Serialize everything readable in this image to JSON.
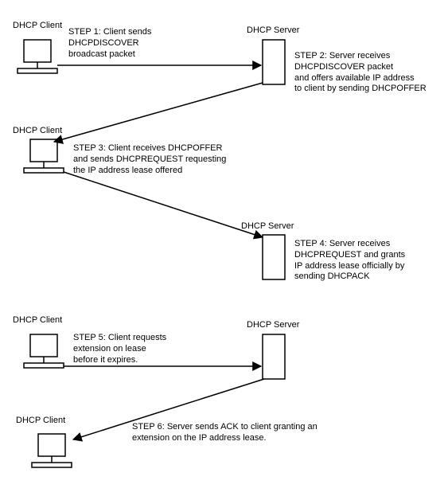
{
  "nodes": {
    "client1_title": "DHCP Client",
    "client2_title": "DHCP Client",
    "client3_title": "DHCP Client",
    "client4_title": "DHCP Client",
    "server1_title": "DHCP Server",
    "server2_title": "DHCP Server",
    "server3_title": "DHCP Server"
  },
  "steps": {
    "step1": "STEP 1: Client sends\nDHCPDISCOVER\nbroadcast packet",
    "step2": "STEP 2: Server receives\nDHCPDISCOVER packet\nand offers available IP address\nto client by sending DHCPOFFER",
    "step3": "STEP 3: Client receives DHCPOFFER\nand sends DHCPREQUEST requesting\nthe IP address lease offered",
    "step4": "STEP 4: Server receives\nDHCPREQUEST and grants\nIP address lease officially by\nsending DHCPACK",
    "step5": "STEP 5: Client requests\nextension on lease\nbefore it expires.",
    "step6": "STEP 6: Server sends ACK to client granting an\nextension on the IP address lease."
  }
}
